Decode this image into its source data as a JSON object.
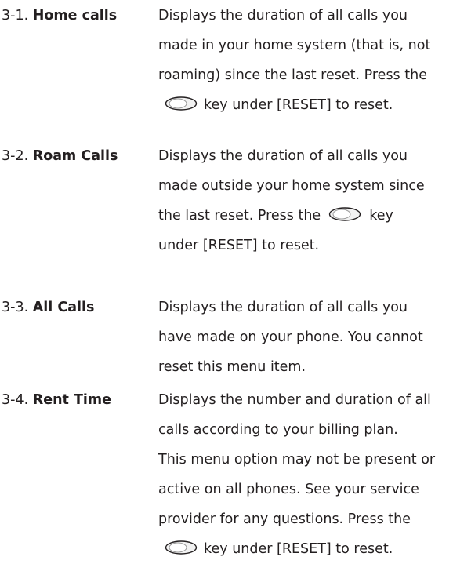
{
  "entries": [
    {
      "number": "3-1.",
      "term": "Home calls",
      "lines": [
        "Displays the duration of all calls you",
        "made in your home system (that is, not",
        "roaming) since the last reset. Press the",
        "key under [RESET] to reset."
      ]
    },
    {
      "number": "3-2.",
      "term": "Roam Calls",
      "lines": [
        "Displays the duration of all calls you",
        "made outside your home system since",
        "the last reset. Press the",
        "key",
        "under [RESET] to reset."
      ]
    },
    {
      "number": "3-3.",
      "term": "All Calls",
      "lines": [
        "Displays the duration of all calls you",
        "have made on your phone. You cannot",
        "reset this menu item."
      ]
    },
    {
      "number": "3-4.",
      "term": "Rent Time",
      "lines": [
        "Displays the number and duration of all",
        "calls according to your billing plan.",
        "This menu option may not be present or",
        "active on all phones. See your service",
        "provider for any questions. Press the",
        "key under [RESET] to reset."
      ]
    }
  ],
  "icons": {
    "softkey": "softkey-button-icon"
  }
}
